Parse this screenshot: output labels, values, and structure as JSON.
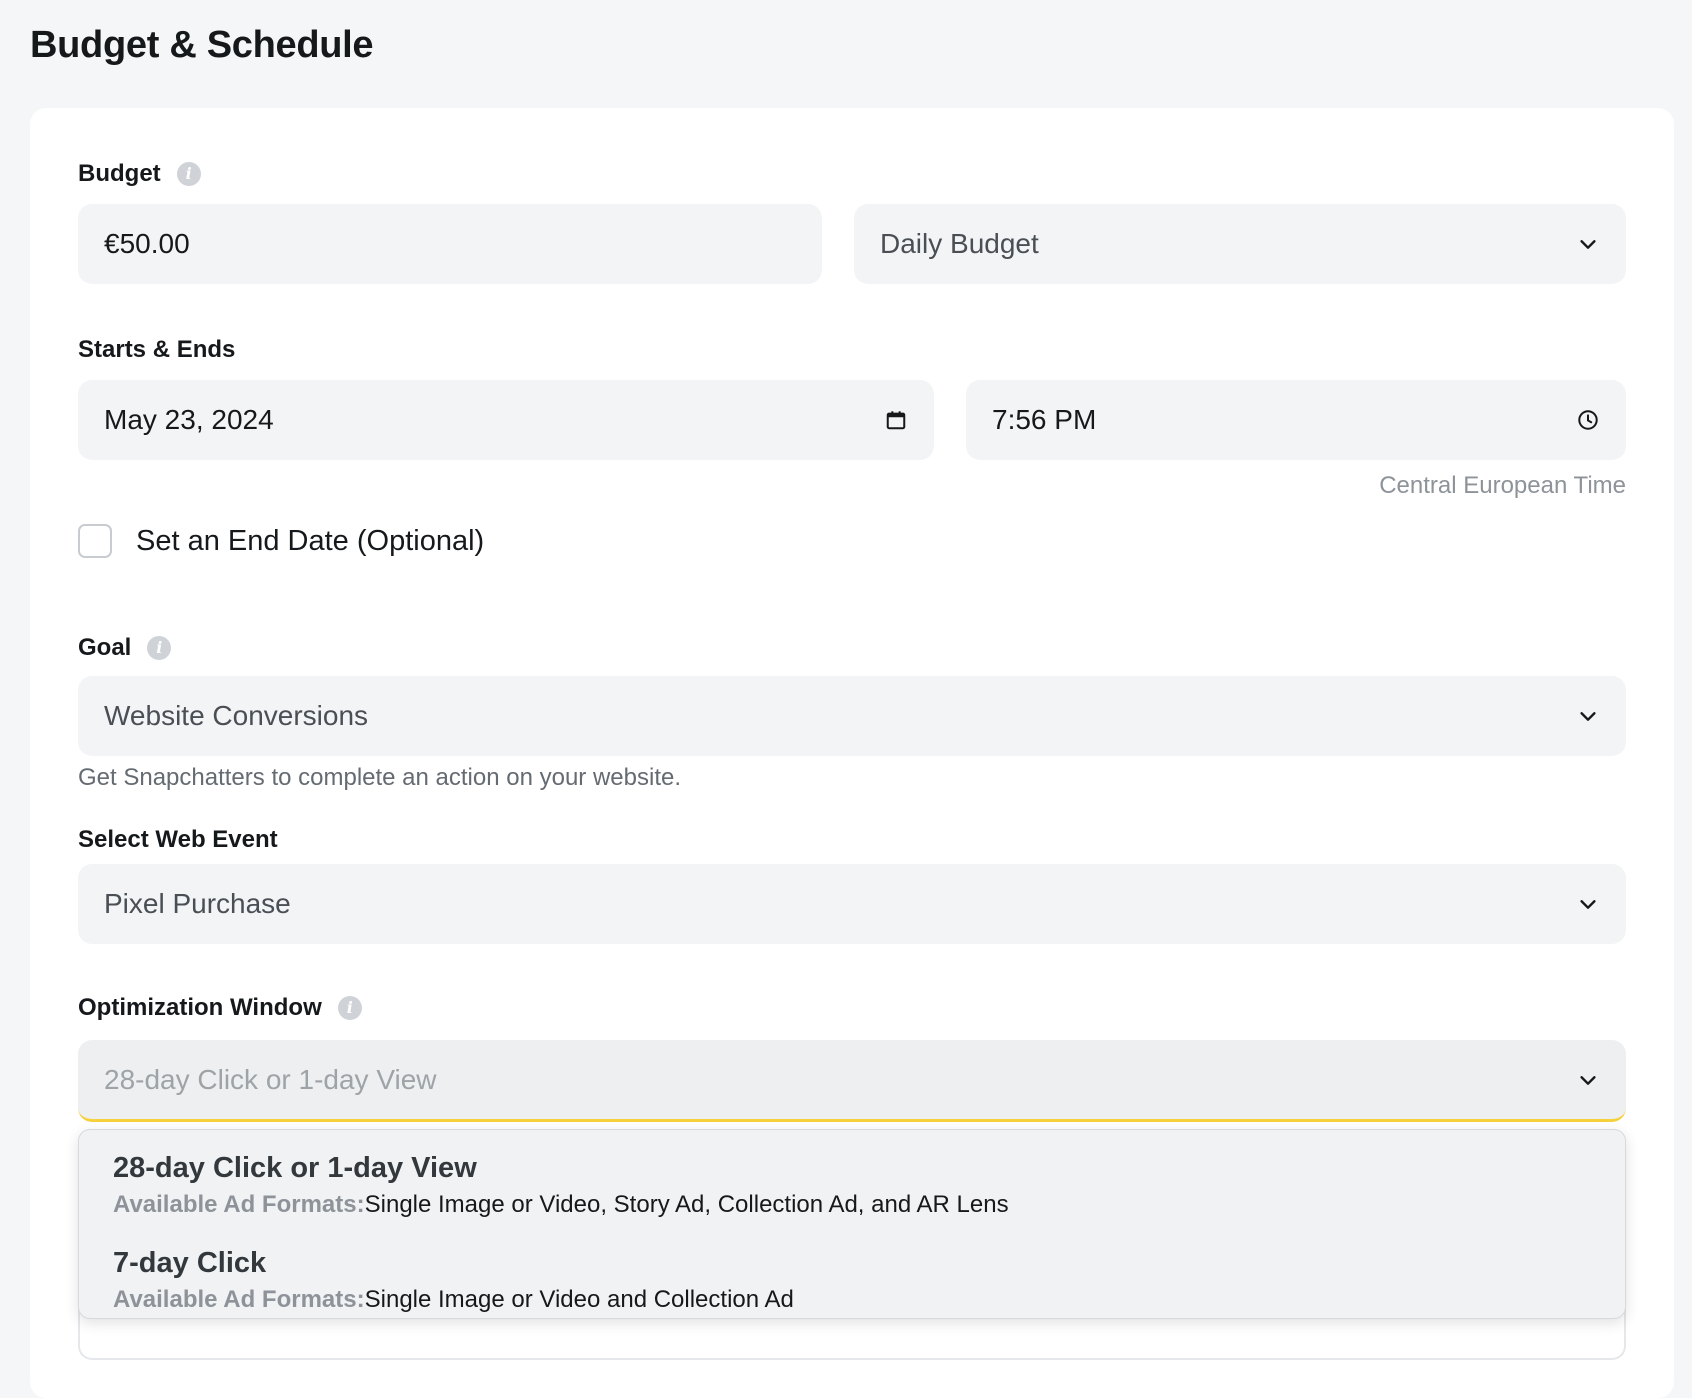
{
  "page": {
    "title": "Budget & Schedule"
  },
  "budget": {
    "label": "Budget",
    "amount": "€50.00",
    "type_selected": "Daily Budget"
  },
  "schedule": {
    "label": "Starts & Ends",
    "start_date": "May 23, 2024",
    "start_time": "7:56 PM",
    "timezone": "Central European Time",
    "end_date_checkbox_label": "Set an End Date (Optional)",
    "end_date_checked": false
  },
  "goal": {
    "label": "Goal",
    "selected": "Website Conversions",
    "helper": "Get Snapchatters to complete an action on your website."
  },
  "web_event": {
    "label": "Select Web Event",
    "selected": "Pixel Purchase"
  },
  "optimization_window": {
    "label": "Optimization Window",
    "placeholder": "28-day Click or 1-day View",
    "options": [
      {
        "title": "28-day Click or 1-day View",
        "formats_key": "Available Ad Formats:",
        "formats_value": "Single Image or Video, Story Ad, Collection Ad, and AR Lens"
      },
      {
        "title": "7-day Click",
        "formats_key": "Available Ad Formats:",
        "formats_value": "Single Image or Video and Collection Ad"
      }
    ]
  },
  "colors": {
    "focus_underline": "#f7d13b",
    "field_bg": "#f3f4f5",
    "page_bg": "#f5f6f7"
  },
  "icons": [
    "info-icon",
    "chevron-down-icon",
    "calendar-icon",
    "clock-icon"
  ]
}
